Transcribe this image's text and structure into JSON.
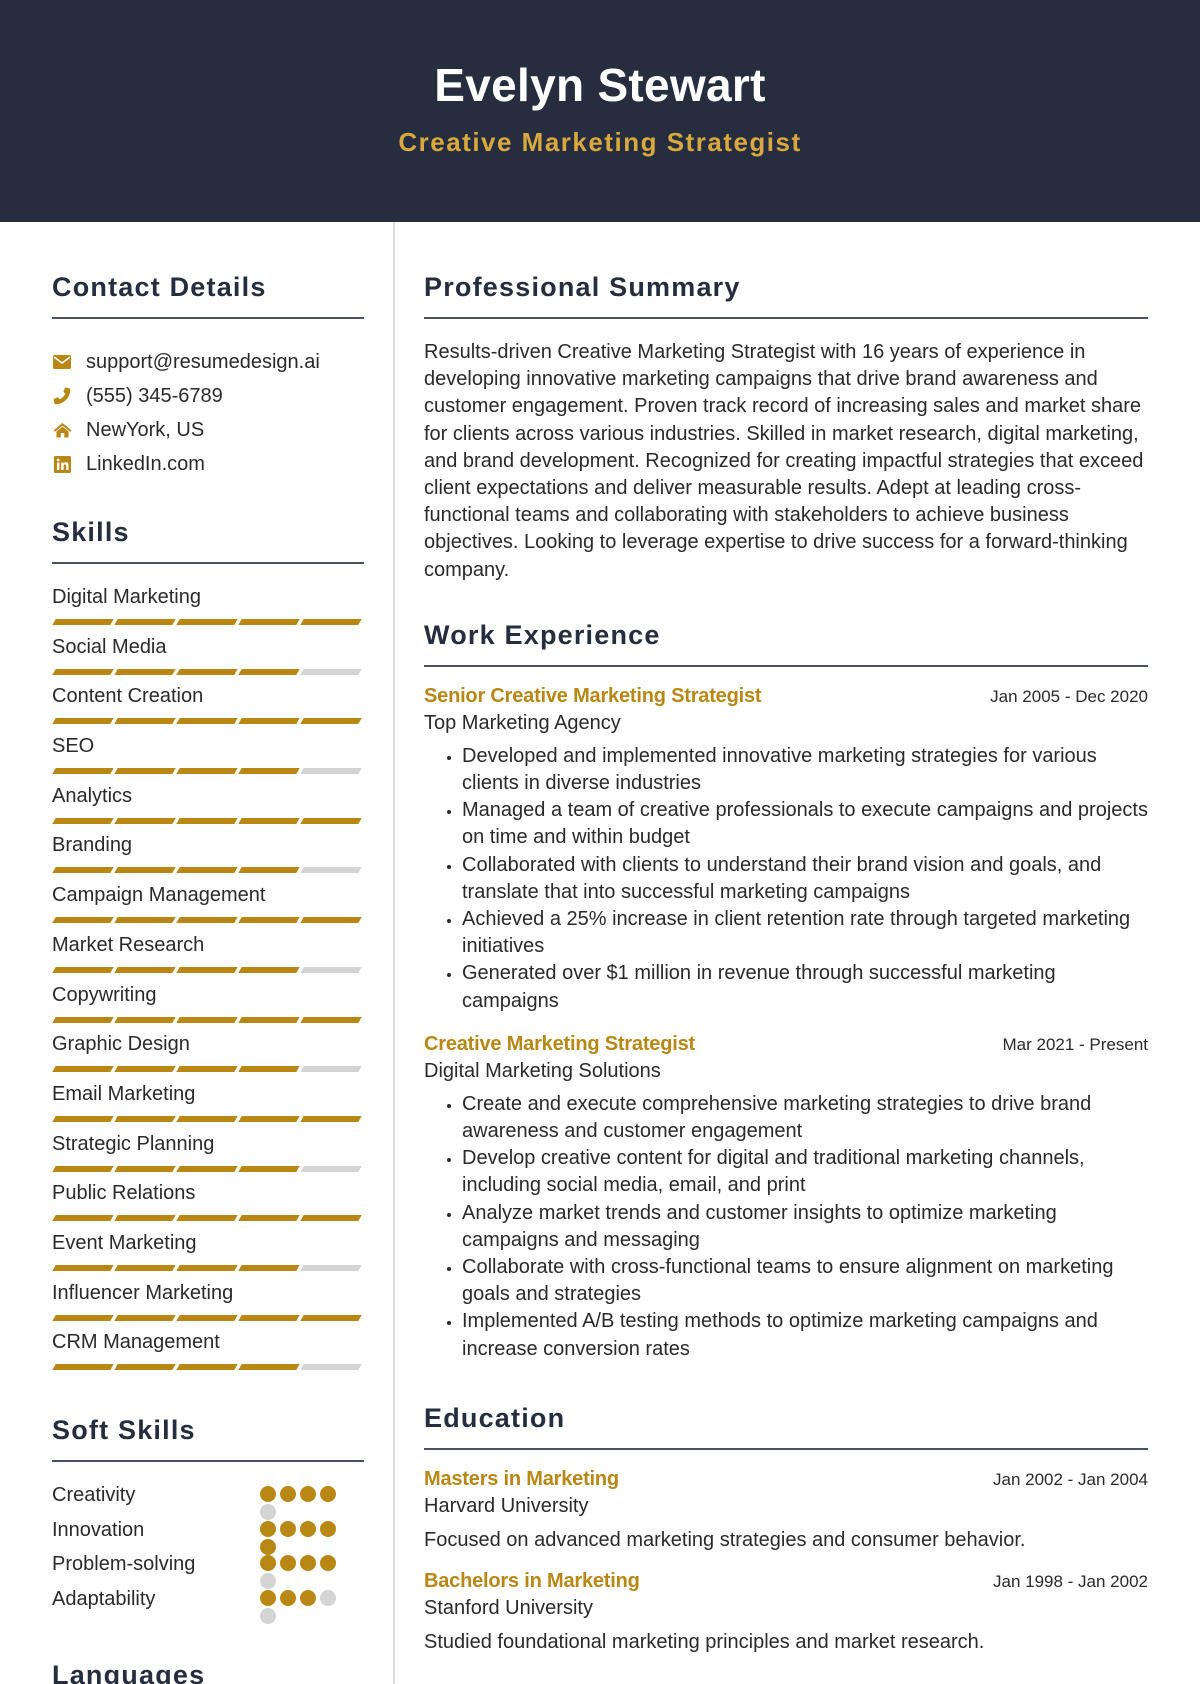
{
  "header": {
    "name": "Evelyn Stewart",
    "title": "Creative Marketing Strategist"
  },
  "colors": {
    "header_bg": "#252d3e",
    "accent": "#b98714",
    "title_gold": "#d9a83e",
    "inactive": "#d4d4d4"
  },
  "contact": {
    "heading": "Contact Details",
    "items": [
      {
        "icon": "envelope-icon",
        "text": "support@resumedesign.ai"
      },
      {
        "icon": "phone-icon",
        "text": "(555) 345-6789"
      },
      {
        "icon": "home-icon",
        "text": "NewYork, US"
      },
      {
        "icon": "linkedin-icon",
        "text": "LinkedIn.com"
      }
    ]
  },
  "skills": {
    "heading": "Skills",
    "max_level": 5,
    "items": [
      {
        "name": "Digital Marketing",
        "level": 5
      },
      {
        "name": "Social Media",
        "level": 4
      },
      {
        "name": "Content Creation",
        "level": 5
      },
      {
        "name": "SEO",
        "level": 4
      },
      {
        "name": "Analytics",
        "level": 5
      },
      {
        "name": "Branding",
        "level": 4
      },
      {
        "name": "Campaign Management",
        "level": 5
      },
      {
        "name": "Market Research",
        "level": 4
      },
      {
        "name": "Copywriting",
        "level": 5
      },
      {
        "name": "Graphic Design",
        "level": 4
      },
      {
        "name": "Email Marketing",
        "level": 5
      },
      {
        "name": "Strategic Planning",
        "level": 4
      },
      {
        "name": "Public Relations",
        "level": 5
      },
      {
        "name": "Event Marketing",
        "level": 4
      },
      {
        "name": "Influencer Marketing",
        "level": 5
      },
      {
        "name": "CRM Management",
        "level": 4
      }
    ]
  },
  "soft_skills": {
    "heading": "Soft Skills",
    "max_level": 5,
    "items": [
      {
        "name": "Creativity",
        "level": 4
      },
      {
        "name": "Innovation",
        "level": 5
      },
      {
        "name": "Problem-solving",
        "level": 4
      },
      {
        "name": "Adaptability",
        "level": 3
      }
    ]
  },
  "languages": {
    "heading": "Languages"
  },
  "summary": {
    "heading": "Professional Summary",
    "text": "Results-driven Creative Marketing Strategist with 16 years of experience in developing innovative marketing campaigns that drive brand awareness and customer engagement. Proven track record of increasing sales and market share for clients across various industries. Skilled in market research, digital marketing, and brand development. Recognized for creating impactful strategies that exceed client expectations and deliver measurable results. Adept at leading cross-functional teams and collaborating with stakeholders to achieve business objectives. Looking to leverage expertise to drive success for a forward-thinking company."
  },
  "experience": {
    "heading": "Work Experience",
    "jobs": [
      {
        "title": "Senior Creative Marketing Strategist",
        "dates": "Jan 2005 - Dec 2020",
        "company": "Top Marketing Agency",
        "bullets": [
          "Developed and implemented innovative marketing strategies for various clients in diverse industries",
          "Managed a team of creative professionals to execute campaigns and projects on time and within budget",
          "Collaborated with clients to understand their brand vision and goals, and translate that into successful marketing campaigns",
          "Achieved a 25% increase in client retention rate through targeted marketing initiatives",
          "Generated over $1 million in revenue through successful marketing campaigns"
        ]
      },
      {
        "title": "Creative Marketing Strategist",
        "dates": "Mar 2021 - Present",
        "company": "Digital Marketing Solutions",
        "bullets": [
          "Create and execute comprehensive marketing strategies to drive brand awareness and customer engagement",
          "Develop creative content for digital and traditional marketing channels, including social media, email, and print",
          "Analyze market trends and customer insights to optimize marketing campaigns and messaging",
          "Collaborate with cross-functional teams to ensure alignment on marketing goals and strategies",
          "Implemented A/B testing methods to optimize marketing campaigns and increase conversion rates"
        ]
      }
    ]
  },
  "education": {
    "heading": "Education",
    "items": [
      {
        "degree": "Masters in Marketing",
        "dates": "Jan 2002 - Jan 2004",
        "school": "Harvard University",
        "description": "Focused on advanced marketing strategies and consumer behavior."
      },
      {
        "degree": "Bachelors in Marketing",
        "dates": "Jan 1998 - Jan 2002",
        "school": "Stanford University",
        "description": "Studied foundational marketing principles and market research."
      }
    ]
  }
}
